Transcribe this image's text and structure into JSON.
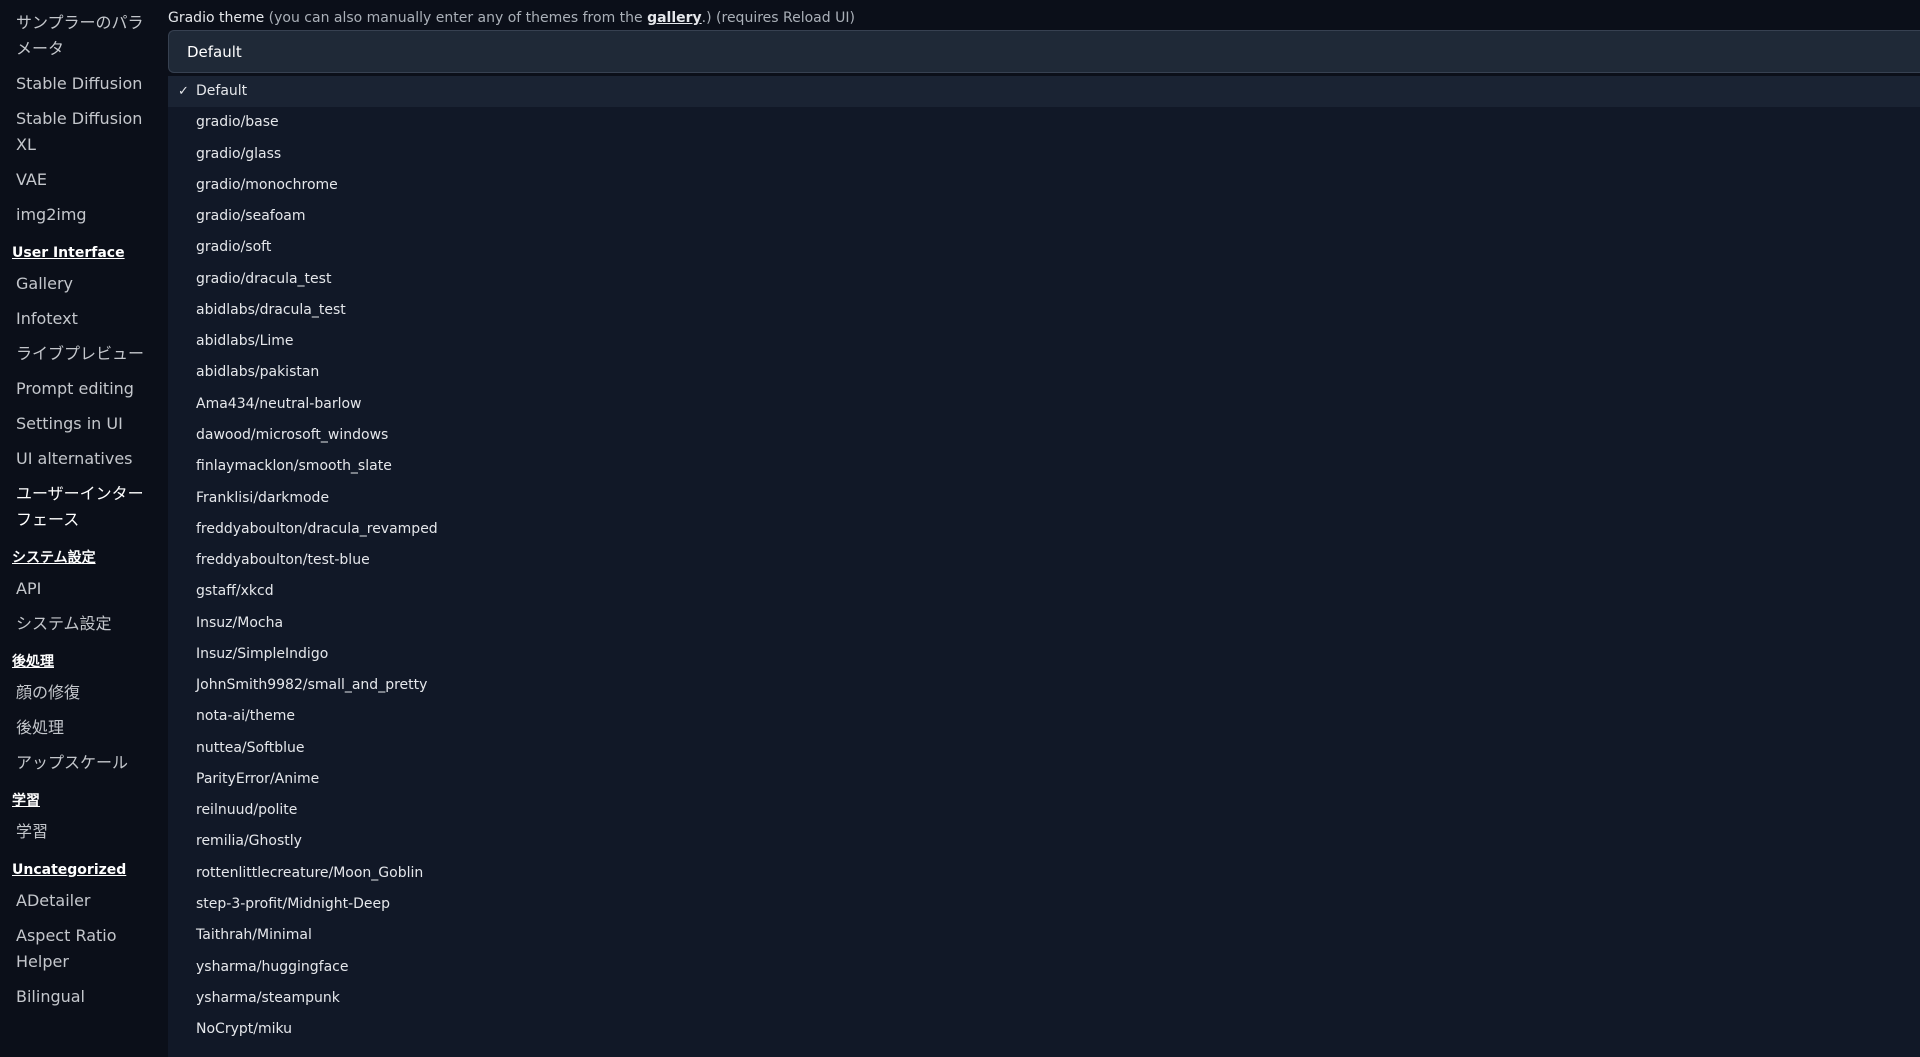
{
  "sidebar": {
    "items": [
      {
        "type": "item",
        "label": "サンプラーのパラメータ"
      },
      {
        "type": "item",
        "label": "Stable Diffusion"
      },
      {
        "type": "item",
        "label": "Stable Diffusion XL"
      },
      {
        "type": "item",
        "label": "VAE"
      },
      {
        "type": "item",
        "label": "img2img"
      },
      {
        "type": "section",
        "label": "User Interface"
      },
      {
        "type": "item",
        "label": "Gallery"
      },
      {
        "type": "item",
        "label": "Infotext"
      },
      {
        "type": "item",
        "label": "ライブプレビュー"
      },
      {
        "type": "item",
        "label": "Prompt editing"
      },
      {
        "type": "item",
        "label": "Settings in UI"
      },
      {
        "type": "item",
        "label": "UI alternatives"
      },
      {
        "type": "item",
        "label": "ユーザーインターフェース",
        "active": true
      },
      {
        "type": "section",
        "label": "システム設定"
      },
      {
        "type": "item",
        "label": "API"
      },
      {
        "type": "item",
        "label": "システム設定"
      },
      {
        "type": "section",
        "label": "後処理"
      },
      {
        "type": "item",
        "label": "顔の修復"
      },
      {
        "type": "item",
        "label": "後処理"
      },
      {
        "type": "item",
        "label": "アップスケール"
      },
      {
        "type": "section",
        "label": "学習"
      },
      {
        "type": "item",
        "label": "学習"
      },
      {
        "type": "section",
        "label": "Uncategorized"
      },
      {
        "type": "item",
        "label": "ADetailer"
      },
      {
        "type": "item",
        "label": "Aspect Ratio Helper"
      },
      {
        "type": "item",
        "label": "Bilingual"
      }
    ]
  },
  "setting": {
    "label_main": "Gradio theme",
    "label_note_pre": " (you can also manually enter any of themes from the ",
    "label_link": "gallery",
    "label_note_post": ".) (requires Reload UI)",
    "value": "Default"
  },
  "dropdown": {
    "check_glyph": "✓",
    "selected_index": 0,
    "options": [
      "Default",
      "gradio/base",
      "gradio/glass",
      "gradio/monochrome",
      "gradio/seafoam",
      "gradio/soft",
      "gradio/dracula_test",
      "abidlabs/dracula_test",
      "abidlabs/Lime",
      "abidlabs/pakistan",
      "Ama434/neutral-barlow",
      "dawood/microsoft_windows",
      "finlaymacklon/smooth_slate",
      "Franklisi/darkmode",
      "freddyaboulton/dracula_revamped",
      "freddyaboulton/test-blue",
      "gstaff/xkcd",
      "Insuz/Mocha",
      "Insuz/SimpleIndigo",
      "JohnSmith9982/small_and_pretty",
      "nota-ai/theme",
      "nuttea/Softblue",
      "ParityError/Anime",
      "reilnuud/polite",
      "remilia/Ghostly",
      "rottenlittlecreature/Moon_Goblin",
      "step-3-profit/Midnight-Deep",
      "Taithrah/Minimal",
      "ysharma/huggingface",
      "ysharma/steampunk",
      "NoCrypt/miku"
    ]
  },
  "colors": {
    "background": "#0b0f19",
    "dropdown_bg": "#111827",
    "input_bg": "#1f2937",
    "text": "#e5e7eb"
  }
}
